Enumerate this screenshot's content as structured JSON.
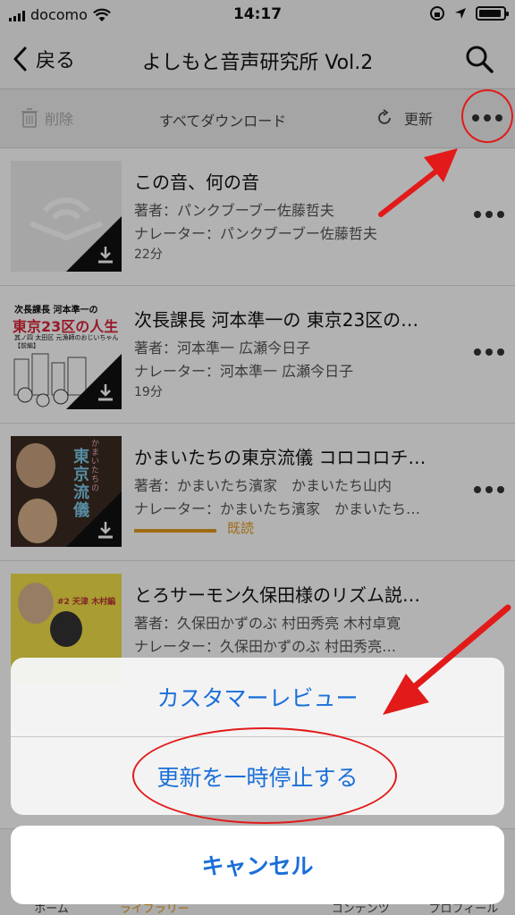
{
  "status_bar": {
    "carrier": "docomo",
    "time": "14:17"
  },
  "nav": {
    "back_label": "戻る",
    "title": "よしもと音声研究所 Vol.2"
  },
  "toolbar": {
    "delete_label": "削除",
    "download_all_label": "すべてダウンロード",
    "refresh_label": "更新"
  },
  "items": [
    {
      "title": "この音、何の音",
      "author": "著者：パンクブーブー佐藤哲夫",
      "narrator": "ナレーター：パンクブーブー佐藤哲夫",
      "duration": "22分",
      "cover": "placeholder"
    },
    {
      "title": "次長課長 河本準一の 東京23区の…",
      "author": "著者：河本準一 広瀬今日子",
      "narrator": "ナレーター：河本準一 広瀬今日子",
      "duration": "19分",
      "cover": "tokyo23",
      "cover_text": {
        "line1": "次長課長 河本準一の",
        "line2": "東京23区の人生",
        "line3": "其ノ四 太田区 元漁師のおじいちゃん【前編】"
      }
    },
    {
      "title": "かまいたちの東京流儀 コロコロチ…",
      "author": "著者：かまいたち濱家　かまいたち山内",
      "narrator": "ナレーター：かまいたち濱家　かまいたち…",
      "status": "既読",
      "progress": 0.72,
      "cover": "kamaitachi",
      "cover_text": {
        "line1": "かまいたちの",
        "line2": "東京流儀"
      }
    },
    {
      "title": "とろサーモン久保田様のリズム説…",
      "author": "著者：久保田かずのぶ 村田秀亮 木村卓寛",
      "narrator": "ナレーター：久保田かずのぶ 村田秀亮…",
      "cover": "torosalmon",
      "cover_text": {
        "line1": "#2 天津 木村編"
      }
    }
  ],
  "action_sheet": {
    "options": [
      "カスタマーレビュー",
      "更新を一時停止する"
    ],
    "cancel_label": "キャンセル"
  },
  "tabbar": {
    "tabs": [
      "ホーム",
      "ライブラリー",
      "",
      "コンテンツ",
      "プロフィール"
    ],
    "active_index": 1
  },
  "colors": {
    "accent": "#e39a1e",
    "link_blue": "#1a6fd9",
    "annotation_red": "#e21a1a"
  }
}
